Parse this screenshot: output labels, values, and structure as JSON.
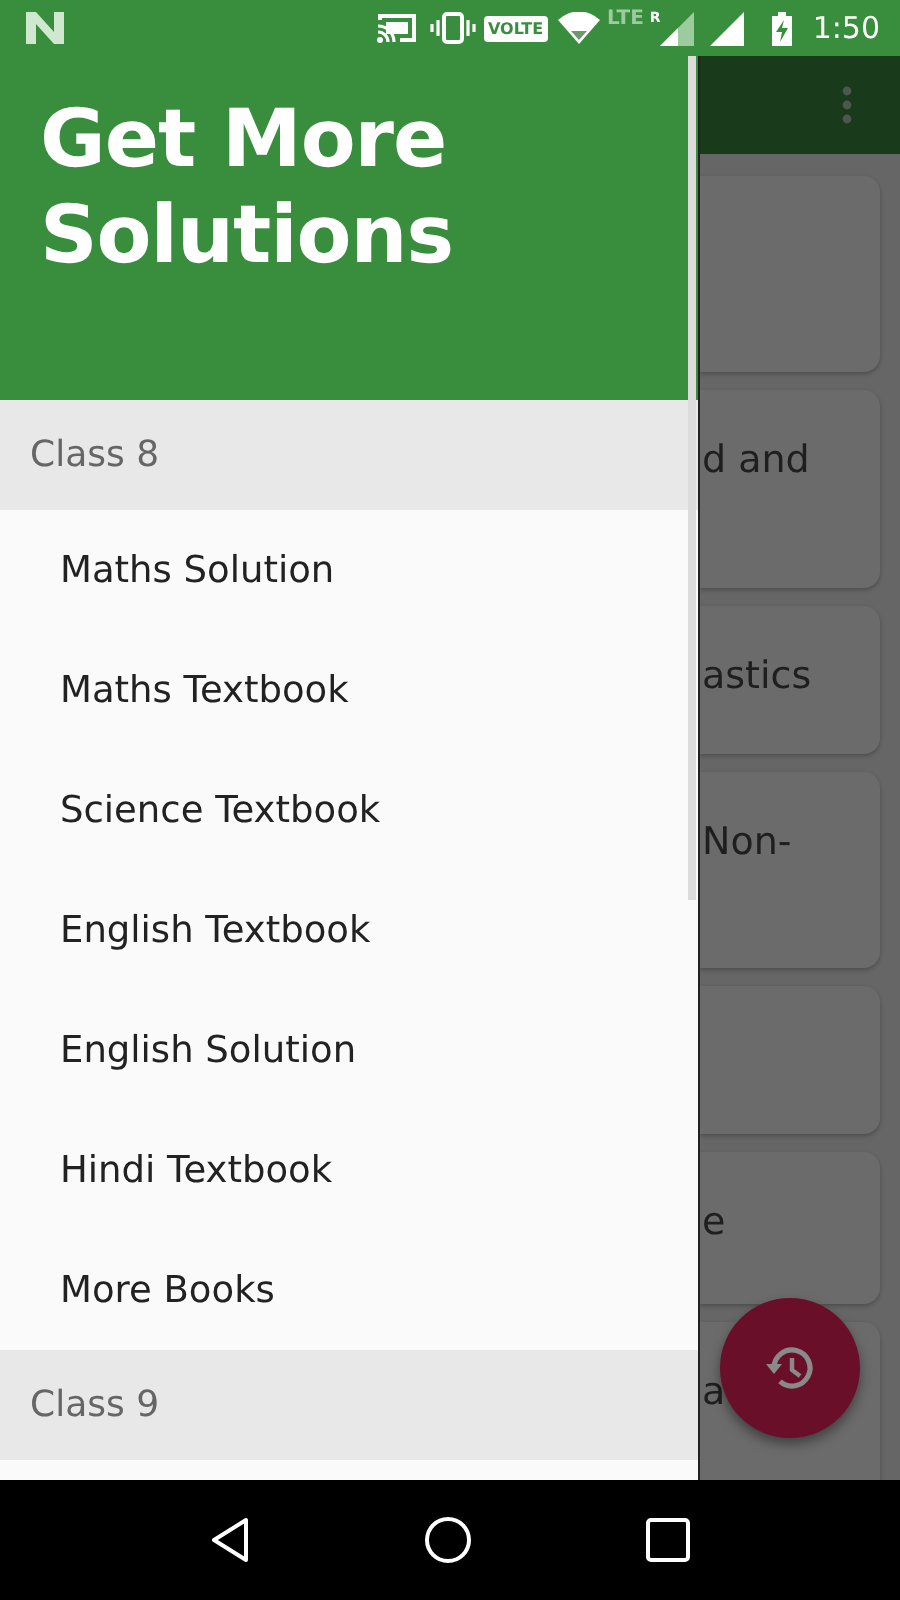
{
  "status_bar": {
    "volte": "VOLTE",
    "network": "LTE",
    "roaming": "R",
    "time": "1:50"
  },
  "background": {
    "cards": [
      {
        "kind": "empty"
      },
      {
        "kind": "text",
        "text": "d and"
      },
      {
        "kind": "text",
        "text": "astics"
      },
      {
        "kind": "text",
        "text": "Non-"
      },
      {
        "kind": "empty"
      },
      {
        "kind": "text",
        "text": "e"
      },
      {
        "kind": "text",
        "text": "a"
      }
    ]
  },
  "drawer": {
    "title": "Get More Solutions",
    "sections": [
      {
        "label": "Class 8",
        "items": [
          "Maths Solution",
          "Maths Textbook",
          "Science Textbook",
          "English Textbook",
          "English Solution",
          "Hindi Textbook",
          "More Books"
        ]
      },
      {
        "label": "Class 9"
      }
    ]
  }
}
